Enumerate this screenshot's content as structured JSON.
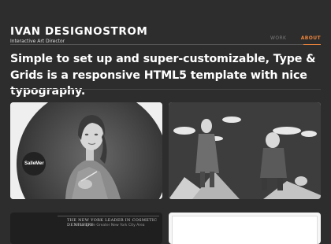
{
  "header": {
    "name": "IVAN DESIGNOSTROM",
    "tagline": "Interactive Art Director"
  },
  "nav": {
    "items": [
      {
        "label": "WORK",
        "state": "default"
      },
      {
        "label": "ABOUT",
        "state": "active"
      }
    ],
    "accent_color": "#e8823a"
  },
  "headline": "Simple to set up and super-customizable, Type & Grids is a responsive HTML5 template with nice typography.",
  "tiles": {
    "tile1": {
      "badge": "SalleMer"
    },
    "tile3": {
      "title": "THE NEW YORK LEADER IN COSMETIC DENTISTRY",
      "subtitle": "Serving the Greater New York City Area"
    }
  }
}
